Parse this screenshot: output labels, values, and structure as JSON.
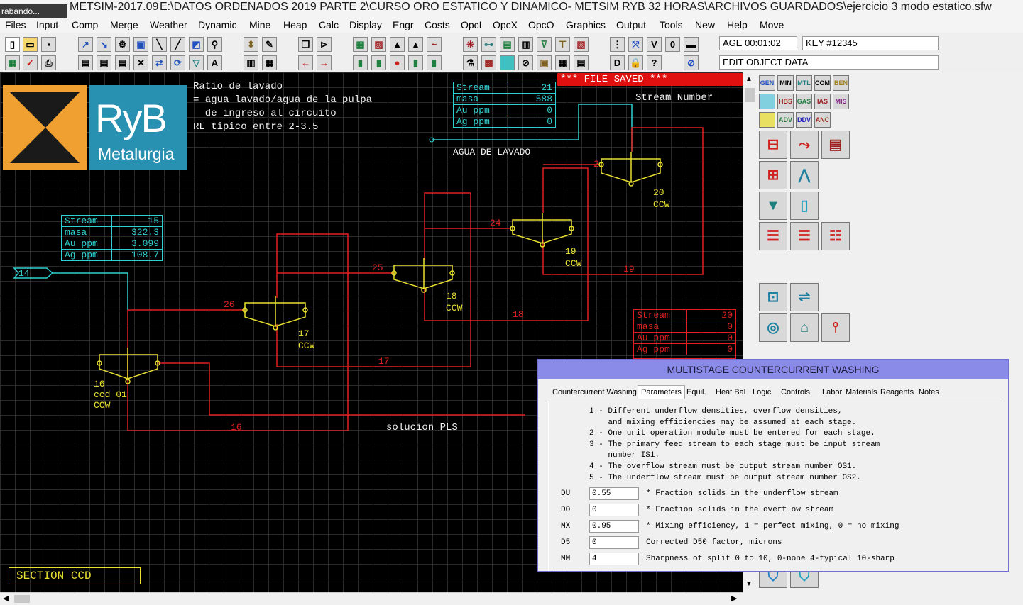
{
  "window": {
    "grab_chip": "rabando...",
    "app_name": "METSIM-2017.09",
    "title_path": "E:\\DATOS ORDENADOS 2019 PARTE 2\\CURSO ORO ESTATICO  Y DINAMICO- METSIM RYB 32 HORAS\\ARCHIVOS GUARDADOS\\ejercicio 3 modo estatico.sfw"
  },
  "menu": [
    "Files",
    "Input",
    "Comp",
    "Merge",
    "Weather",
    "Dynamic",
    "Mine",
    "Heap",
    "Calc",
    "Display",
    "Engr",
    "Costs",
    "OpcI",
    "OpcX",
    "OpcO",
    "Graphics",
    "Output",
    "Tools",
    "New",
    "Help",
    "Move"
  ],
  "toolbar": {
    "age": "AGE 00:01:02",
    "key": "KEY #12345",
    "status": "EDIT OBJECT DATA"
  },
  "canvas": {
    "file_saved": "*** FILE SAVED ***",
    "stream_number_label": "Stream Number",
    "logo_text_big": "RyB",
    "logo_text_small": "Metalurgia",
    "note_lines": [
      "Ratio de lavado",
      "= agua lavado/agua de la pulpa",
      "  de ingreso al circuito",
      "RL tipico entre 2-3.5"
    ],
    "agua_label": "AGUA DE LAVADO",
    "pls_label": "solucion PLS",
    "section_label": "SECTION CCD",
    "feed_stream": "14",
    "table_top": {
      "rows": [
        [
          "Stream",
          "21"
        ],
        [
          "masa",
          "588"
        ],
        [
          "Au ppm",
          "0"
        ],
        [
          "Ag ppm",
          "0"
        ]
      ]
    },
    "table_left": {
      "rows": [
        [
          "Stream",
          "15"
        ],
        [
          "masa",
          "322.3"
        ],
        [
          "Au ppm",
          "3.099"
        ],
        [
          "Ag ppm",
          "108.7"
        ]
      ]
    },
    "table_right": {
      "rows": [
        [
          "Stream",
          "20"
        ],
        [
          "masa",
          "0"
        ],
        [
          "Au ppm",
          "0"
        ],
        [
          "Ag ppm",
          "0"
        ]
      ]
    },
    "units": [
      {
        "num": "16",
        "name": "ccd 01",
        "type": "CCW"
      },
      {
        "num": "17",
        "name": "",
        "type": "CCW"
      },
      {
        "num": "18",
        "name": "",
        "type": "CCW"
      },
      {
        "num": "19",
        "name": "",
        "type": "CCW"
      },
      {
        "num": "20",
        "name": "",
        "type": "CCW"
      }
    ],
    "stream_labels": [
      "26",
      "25",
      "24",
      "2",
      "19",
      "18",
      "17",
      "16"
    ]
  },
  "palette": {
    "row1": [
      "GEN",
      "MIN",
      "MTL",
      "COM",
      "BEN"
    ],
    "row2": [
      "",
      "HBS",
      "GAS",
      "IAS",
      "MIS"
    ],
    "row3": [
      "",
      "ADV",
      "DDV",
      "ANC"
    ]
  },
  "dialog": {
    "title": "MULTISTAGE COUNTERCURRENT WASHING",
    "tabs": [
      "Countercurrent Washing",
      "Parameters",
      "Equil.",
      "Heat Bal",
      "Logic",
      "Controls",
      "Labor",
      "Materials",
      "Reagents",
      "Notes"
    ],
    "notes": [
      "1 - Different underflow densities, overflow densities,",
      "    and mixing efficiencies may be assumed at each stage.",
      "2 - One unit operation module must be entered for each stage.",
      "3 - The primary feed stream to each stage must be input stream",
      "    number IS1.",
      "4 - The overflow stream must be output stream number OS1.",
      "5 - The underflow stream must be output stream number OS2."
    ],
    "params": [
      {
        "label": "DU",
        "value": "0.55",
        "desc": "* Fraction solids in the underflow stream"
      },
      {
        "label": "DO",
        "value": "0",
        "desc": "* Fraction solids in the overflow stream"
      },
      {
        "label": "MX",
        "value": "0.95",
        "desc": "* Mixing efficiency, 1 = perfect mixing, 0 = no mixing"
      },
      {
        "label": "D5",
        "value": "0",
        "desc": "  Corrected D50 factor, microns"
      },
      {
        "label": "MM",
        "value": "4",
        "desc": "  Sharpness of split 0 to 10, 0-none 4-typical 10-sharp"
      }
    ]
  }
}
